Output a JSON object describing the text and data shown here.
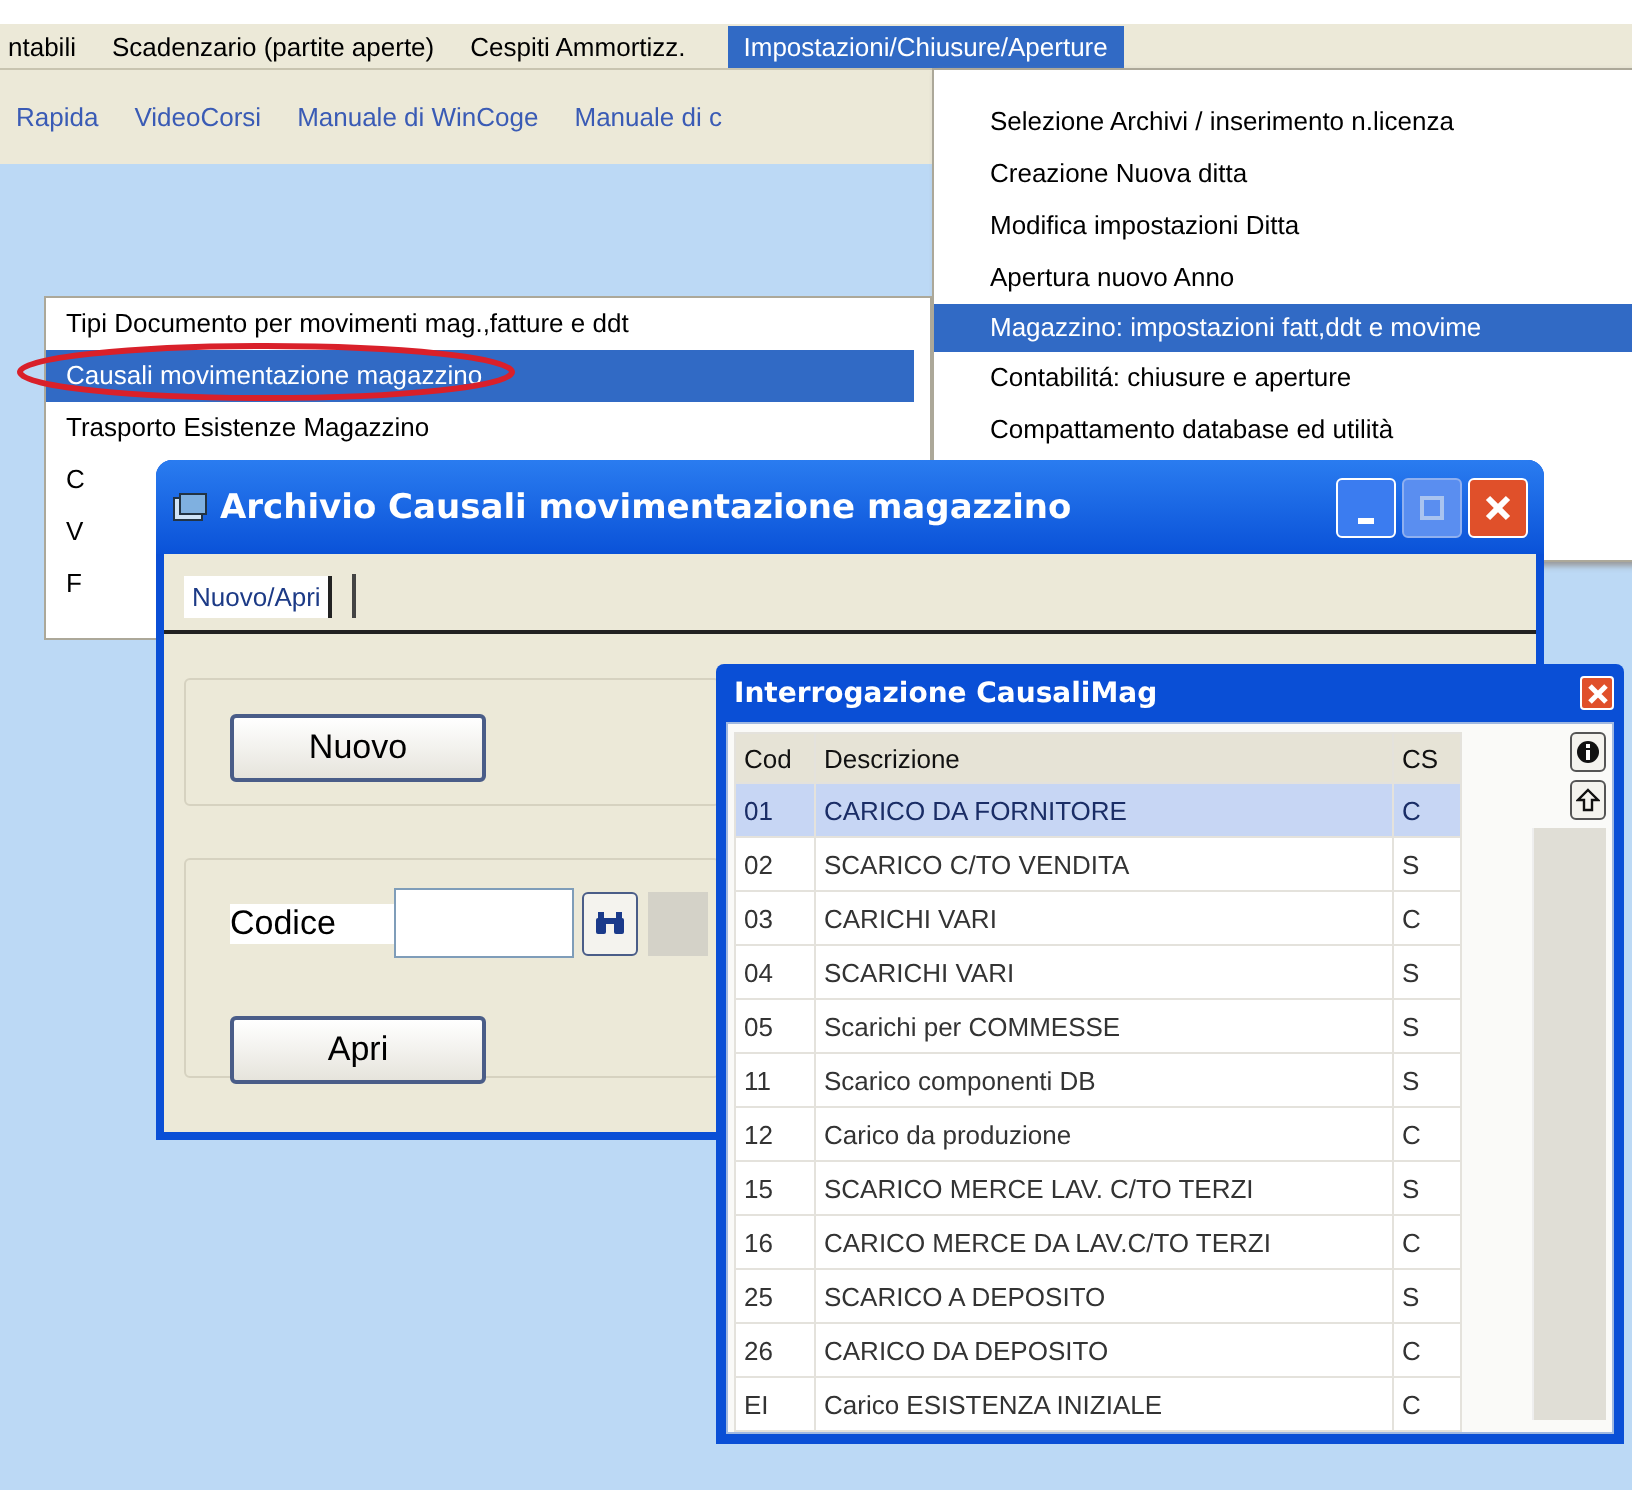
{
  "menu_bar": {
    "items": [
      {
        "label": "ntabili",
        "selected": false
      },
      {
        "label": "Scadenzario (partite aperte)",
        "selected": false
      },
      {
        "label": "Cespiti Ammortizz.",
        "selected": false
      },
      {
        "label": "Impostazioni/Chiusure/Aperture",
        "selected": true
      }
    ]
  },
  "toolbar": {
    "links": [
      "Rapida",
      "VideoCorsi",
      "Manuale di WinCoge",
      "Manuale di c"
    ]
  },
  "settings_menu": {
    "items": [
      {
        "label": "Selezione Archivi / inserimento n.licenza",
        "selected": false
      },
      {
        "label": "Creazione Nuova ditta",
        "selected": false
      },
      {
        "label": "Modifica impostazioni Ditta",
        "selected": false
      },
      {
        "label": "Apertura nuovo Anno",
        "selected": false
      },
      {
        "label": "Magazzino: impostazioni fatt,ddt e movime",
        "selected": true
      },
      {
        "label": "Contabilitá: chiusure e aperture",
        "selected": false
      },
      {
        "label": "Compattamento database ed utilità",
        "selected": false
      }
    ]
  },
  "submenu": {
    "items": [
      {
        "label": "Tipi Documento per movimenti mag.,fatture e ddt",
        "selected": false
      },
      {
        "label": "Causali movimentazione magazzino",
        "selected": true,
        "circled": true
      },
      {
        "label": "Trasporto Esistenze Magazzino",
        "selected": false
      },
      {
        "label": "C",
        "selected": false
      },
      {
        "label": "V",
        "selected": false
      },
      {
        "label": "F",
        "selected": false
      }
    ]
  },
  "archive_window": {
    "title": "Archivio Causali movimentazione magazzino",
    "tabs": [
      {
        "label": "Nuovo/Apri",
        "selected": true
      }
    ],
    "new_button": "Nuovo",
    "code_label": "Codice",
    "open_button": "Apri"
  },
  "query_window": {
    "title": "Interrogazione CausaliMag",
    "table": {
      "columns": [
        "Cod",
        "Descrizione",
        "CS"
      ],
      "rows": [
        {
          "cells": [
            "01",
            "CARICO DA FORNITORE",
            "C"
          ],
          "selected": true
        },
        {
          "cells": [
            "02",
            "SCARICO C/TO VENDITA",
            "S"
          ],
          "selected": false
        },
        {
          "cells": [
            "03",
            "CARICHI VARI",
            "C"
          ],
          "selected": false
        },
        {
          "cells": [
            "04",
            "SCARICHI VARI",
            "S"
          ],
          "selected": false
        },
        {
          "cells": [
            "05",
            "Scarichi per COMMESSE",
            "S"
          ],
          "selected": false
        },
        {
          "cells": [
            "11",
            "Scarico componenti DB",
            "S"
          ],
          "selected": false
        },
        {
          "cells": [
            "12",
            "Carico da produzione",
            "C"
          ],
          "selected": false
        },
        {
          "cells": [
            "15",
            "SCARICO MERCE LAV. C/TO TERZI",
            "S"
          ],
          "selected": false
        },
        {
          "cells": [
            "16",
            "CARICO MERCE DA LAV.C/TO TERZI",
            "C"
          ],
          "selected": false
        },
        {
          "cells": [
            "25",
            "SCARICO A DEPOSITO",
            "S"
          ],
          "selected": false
        },
        {
          "cells": [
            "26",
            "CARICO DA DEPOSITO",
            "C"
          ],
          "selected": false
        },
        {
          "cells": [
            "EI",
            "Carico ESISTENZA INIZIALE",
            "C"
          ],
          "selected": false
        }
      ]
    }
  }
}
